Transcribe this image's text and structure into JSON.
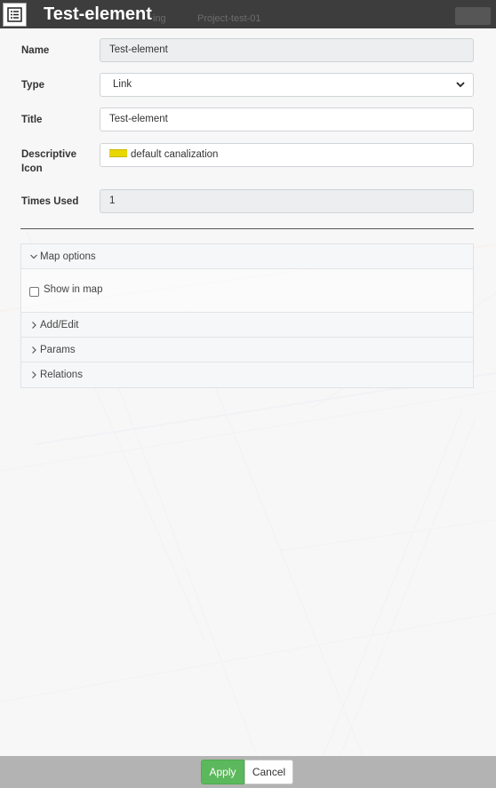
{
  "header": {
    "title": "Test-element",
    "ghost_left": "Project-test-01",
    "ghost_partial": "ing"
  },
  "form": {
    "name": {
      "label": "Name",
      "value": "Test-element"
    },
    "type": {
      "label": "Type",
      "value": "Link",
      "options": [
        "Link"
      ]
    },
    "title": {
      "label": "Title",
      "value": "Test-element"
    },
    "icon": {
      "label": "Descriptive Icon",
      "value": "default canalization",
      "swatch_color": "#e8d800"
    },
    "times_used": {
      "label": "Times Used",
      "value": "1"
    }
  },
  "accordion": {
    "map_options": {
      "label": "Map options",
      "expanded": true,
      "show_in_map_label": "Show in map",
      "show_in_map_checked": false
    },
    "add_edit": {
      "label": "Add/Edit",
      "expanded": false
    },
    "params": {
      "label": "Params",
      "expanded": false
    },
    "relations": {
      "label": "Relations",
      "expanded": false
    }
  },
  "footer": {
    "apply_label": "Apply",
    "cancel_label": "Cancel",
    "apply_color": "#5cb85c"
  }
}
